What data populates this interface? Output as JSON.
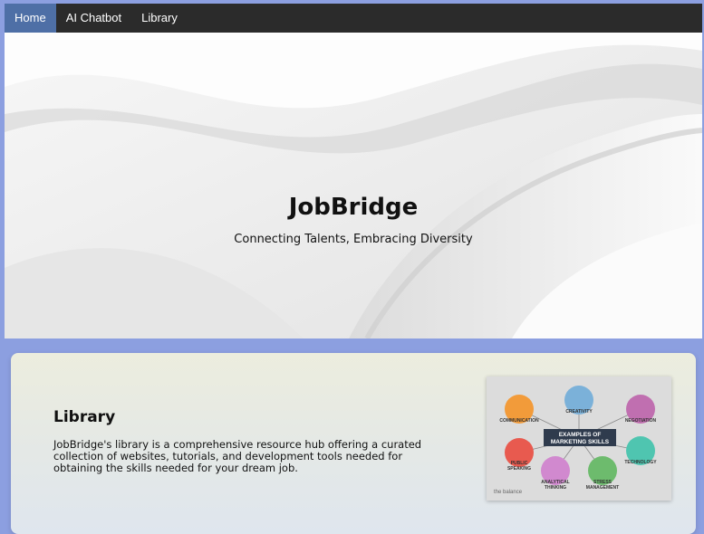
{
  "nav": {
    "items": [
      {
        "label": "Home",
        "active": true
      },
      {
        "label": "AI Chatbot",
        "active": false
      },
      {
        "label": "Library",
        "active": false
      }
    ]
  },
  "hero": {
    "title": "JobBridge",
    "subtitle": "Connecting Talents, Embracing Diversity"
  },
  "library": {
    "title": "Library",
    "description": "JobBridge's library is a comprehensive resource hub offering a curated collection of websites, tutorials, and development tools needed for obtaining the skills needed for your dream job.",
    "image": {
      "heading_line1": "EXAMPLES OF",
      "heading_line2": "MARKETING SKILLS",
      "skills": [
        {
          "label": "CREATIVITY",
          "color": "#7bb1d9"
        },
        {
          "label": "COMMUNICATION",
          "color": "#f29b3a"
        },
        {
          "label": "NEGOTIATION",
          "color": "#c06fb0"
        },
        {
          "label": "TECHNOLOGY",
          "color": "#4fc5b0"
        },
        {
          "label": "PUBLIC",
          "label2": "SPEAKING",
          "color": "#e85a4f"
        },
        {
          "label": "ANALYTICAL",
          "label2": "THINKING",
          "color": "#d189cf"
        },
        {
          "label": "STRESS",
          "label2": "MANAGEMENT",
          "color": "#6dbb6d"
        }
      ],
      "brand": "the balance"
    }
  }
}
